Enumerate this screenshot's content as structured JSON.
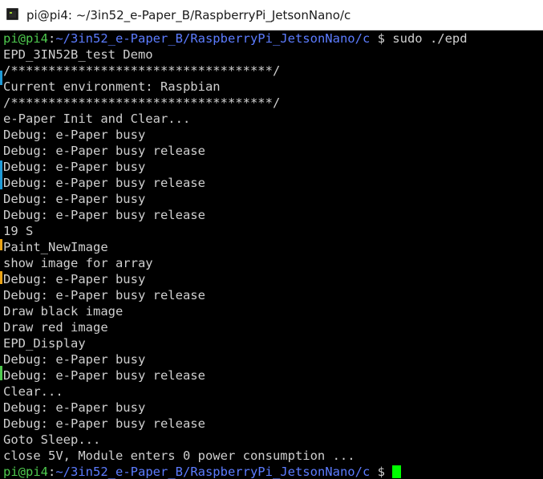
{
  "window": {
    "title": "pi@pi4: ~/3in52_e-Paper_B/RaspberryPi_JetsonNano/c",
    "icon": "terminal-icon"
  },
  "colors": {
    "background": "#000000",
    "text": "#cfcfcf",
    "prompt_user": "#4ec94e",
    "prompt_path": "#5c7cff",
    "cursor": "#00ff00"
  },
  "terminal": {
    "first_prompt": {
      "user_host": "pi@pi4",
      "separator": ":",
      "path": "~/3in52_e-Paper_B/RaspberryPi_JetsonNano/c",
      "symbol": " $ ",
      "command": "sudo ./epd"
    },
    "output": [
      "EPD_3IN52B_test Demo",
      "/***********************************/",
      "Current environment: Raspbian",
      "/***********************************/",
      "e-Paper Init and Clear...",
      "Debug: e-Paper busy",
      "Debug: e-Paper busy release",
      "Debug: e-Paper busy",
      "Debug: e-Paper busy release",
      "Debug: e-Paper busy",
      "Debug: e-Paper busy release",
      "19 S",
      "Paint_NewImage",
      "show image for array",
      "Debug: e-Paper busy",
      "Debug: e-Paper busy release",
      "Draw black image",
      "Draw red image",
      "EPD_Display",
      "Debug: e-Paper busy",
      "Debug: e-Paper busy release",
      "Clear...",
      "Debug: e-Paper busy",
      "Debug: e-Paper busy release",
      "Goto Sleep...",
      "close 5V, Module enters 0 power consumption ..."
    ],
    "last_prompt": {
      "user_host": "pi@pi4",
      "separator": ":",
      "path": "~/3in52_e-Paper_B/RaspberryPi_JetsonNano/c",
      "symbol": " $ "
    }
  }
}
